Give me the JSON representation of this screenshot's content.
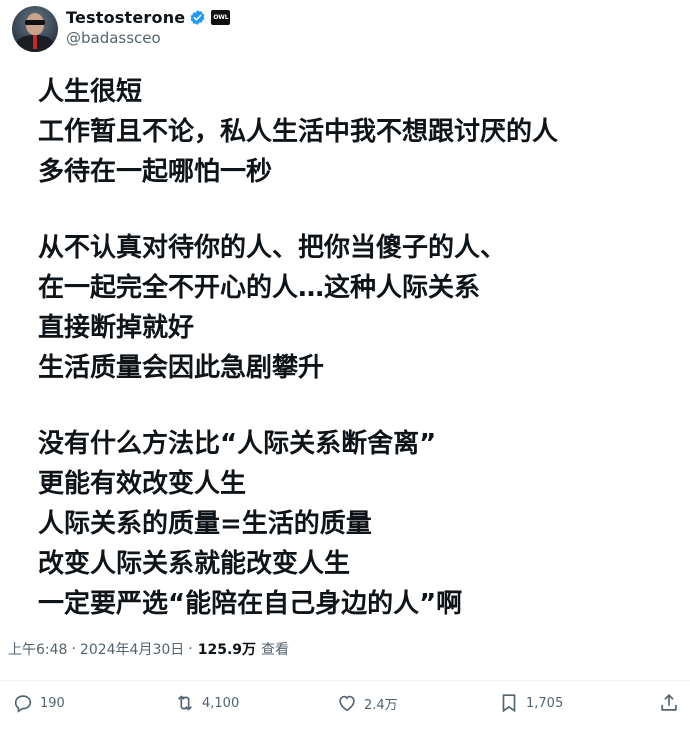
{
  "author": {
    "display_name": "Testosterone",
    "handle": "@badassceo",
    "badge_text": "OWL"
  },
  "tweet": {
    "paragraphs": [
      [
        "人生很短",
        "工作暂且不论，私人生活中我不想跟讨厌的人",
        "多待在一起哪怕一秒"
      ],
      [
        "从不认真对待你的人、把你当傻子的人、",
        "在一起完全不开心的人…这种人际关系",
        "直接断掉就好",
        "生活质量会因此急剧攀升"
      ],
      [
        "没有什么方法比“人际关系断舍离”",
        "更能有效改变人生",
        "人际关系的质量=生活的质量",
        "改变人际关系就能改变人生",
        "一定要严选“能陪在自己身边的人”啊"
      ]
    ]
  },
  "meta": {
    "time": "上午6:48",
    "separator": "·",
    "date": "2024年4月30日",
    "views_count": "125.9万",
    "views_label": "查看"
  },
  "actions": {
    "replies": "190",
    "retweets": "4,100",
    "likes": "2.4万",
    "bookmarks": "1,705"
  },
  "colors": {
    "text": "#0f1419",
    "secondary": "#536471",
    "verified": "#1d9bf0"
  }
}
